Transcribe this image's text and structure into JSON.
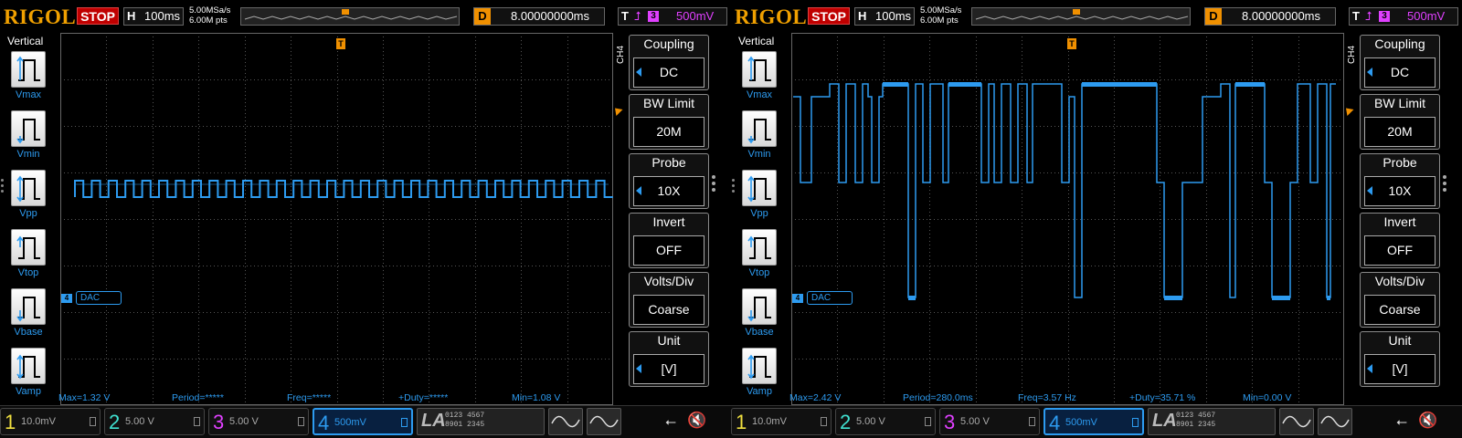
{
  "screens": [
    {
      "id": "left",
      "logo": "RIGOL",
      "status": "STOP",
      "horizontal": {
        "label": "H",
        "value": "100ms"
      },
      "sample_rate": "5.00MSa/s",
      "memory_depth": "6.00M pts",
      "delay": {
        "label": "D",
        "value": "8.00000000ms"
      },
      "trigger": {
        "label": "T",
        "source": "3",
        "level": "500mV"
      },
      "vertical_menu": {
        "title": "Vertical",
        "items": [
          "Vmax",
          "Vmin",
          "Vpp",
          "Vtop",
          "Vbase",
          "Vamp"
        ]
      },
      "channel_side_label": "CH4",
      "channel_label": "DAC",
      "channel_marker": "4",
      "right_menu": [
        {
          "title": "Coupling",
          "value": "DC",
          "arrow": true
        },
        {
          "title": "BW Limit",
          "value": "20M",
          "arrow": false
        },
        {
          "title": "Probe",
          "value": "10X",
          "arrow": true
        },
        {
          "title": "Invert",
          "value": "OFF",
          "arrow": false
        },
        {
          "title": "Volts/Div",
          "value": "Coarse",
          "arrow": false
        },
        {
          "title": "Unit",
          "value": "[V]",
          "arrow": true
        }
      ],
      "measurements": {
        "max": "Max=1.32 V",
        "period": "Period=*****",
        "freq": "Freq=*****",
        "duty": "+Duty=*****",
        "min": "Min=1.08 V"
      },
      "bottom": {
        "ch1": {
          "num": "1",
          "value": "10.0mV"
        },
        "ch2": {
          "num": "2",
          "value": "5.00 V"
        },
        "ch3": {
          "num": "3",
          "value": "5.00 V"
        },
        "ch4": {
          "num": "4",
          "value": "500mV"
        },
        "la": {
          "label": "LA",
          "bits_top": "0123 4567",
          "bits_bottom": "8901 2345"
        }
      },
      "waveform": "square-small",
      "colors": {
        "ch4": "#2d9bf0",
        "ch1": "#f0e040",
        "ch2": "#40e0d0",
        "ch3": "#e040ff",
        "trigger": "#f09000",
        "stop": "#c00000"
      }
    },
    {
      "id": "right",
      "logo": "RIGOL",
      "status": "STOP",
      "horizontal": {
        "label": "H",
        "value": "100ms"
      },
      "sample_rate": "5.00MSa/s",
      "memory_depth": "6.00M pts",
      "delay": {
        "label": "D",
        "value": "8.00000000ms"
      },
      "trigger": {
        "label": "T",
        "source": "3",
        "level": "500mV"
      },
      "vertical_menu": {
        "title": "Vertical",
        "items": [
          "Vmax",
          "Vmin",
          "Vpp",
          "Vtop",
          "Vbase",
          "Vamp"
        ]
      },
      "channel_side_label": "CH4",
      "channel_label": "DAC",
      "channel_marker": "4",
      "right_menu": [
        {
          "title": "Coupling",
          "value": "DC",
          "arrow": true
        },
        {
          "title": "BW Limit",
          "value": "20M",
          "arrow": false
        },
        {
          "title": "Probe",
          "value": "10X",
          "arrow": true
        },
        {
          "title": "Invert",
          "value": "OFF",
          "arrow": false
        },
        {
          "title": "Volts/Div",
          "value": "Coarse",
          "arrow": false
        },
        {
          "title": "Unit",
          "value": "[V]",
          "arrow": true
        }
      ],
      "measurements": {
        "max": "Max=2.42 V",
        "period": "Period=280.0ms",
        "freq": "Freq=3.57 Hz",
        "duty": "+Duty=35.71 %",
        "min": "Min=0.00 V"
      },
      "bottom": {
        "ch1": {
          "num": "1",
          "value": "10.0mV"
        },
        "ch2": {
          "num": "2",
          "value": "5.00 V"
        },
        "ch3": {
          "num": "3",
          "value": "5.00 V"
        },
        "ch4": {
          "num": "4",
          "value": "500mV"
        },
        "la": {
          "label": "LA",
          "bits_top": "0123 4567",
          "bits_bottom": "8901 2345"
        }
      },
      "waveform": "dac-steps",
      "colors": {
        "ch4": "#2d9bf0",
        "ch1": "#f0e040",
        "ch2": "#40e0d0",
        "ch3": "#e040ff",
        "trigger": "#f09000",
        "stop": "#c00000"
      }
    }
  ]
}
